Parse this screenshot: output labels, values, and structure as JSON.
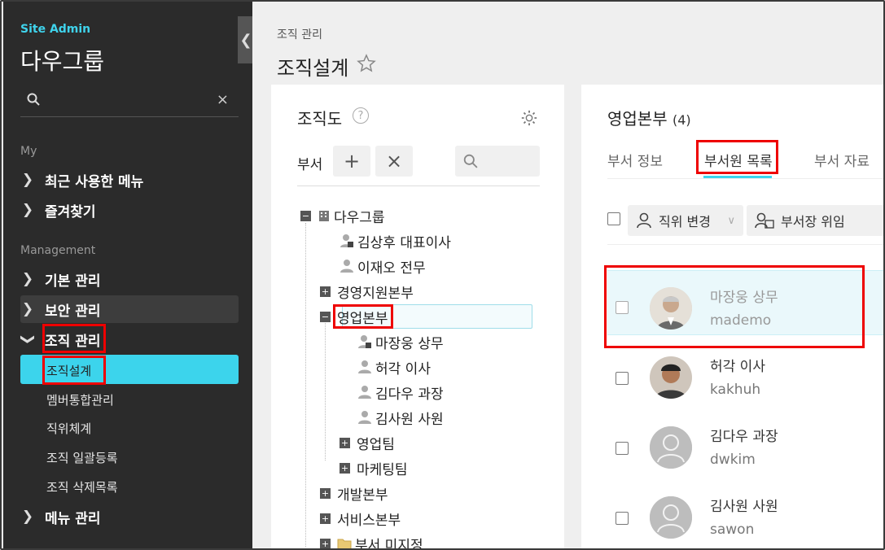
{
  "sidebar": {
    "site_admin": "Site Admin",
    "company": "다우그룹",
    "search_clear": "×",
    "sections": {
      "my": "My",
      "management": "Management"
    },
    "my_items": [
      "최근 사용한 메뉴",
      "즐겨찾기"
    ],
    "management_items": [
      "기본 관리",
      "보안 관리",
      "조직 관리"
    ],
    "org_sub_items": [
      "조직설계",
      "멤버통합관리",
      "직위체계",
      "조직 일괄등록",
      "조직 삭제목록"
    ],
    "last_item": "메뉴 관리"
  },
  "header": {
    "breadcrumb": "조직 관리",
    "title": "조직설계"
  },
  "org_panel": {
    "title": "조직도",
    "help": "?",
    "dept_label": "부서",
    "add": "+",
    "remove": "×",
    "tree": {
      "root": "다우그룹",
      "root_members": [
        "김상후 대표이사",
        "이재오 전무"
      ],
      "d1": "경영지원본부",
      "d2": "영업본부",
      "d2_members": [
        "마장웅 상무",
        "허각 이사",
        "김다우 과장",
        "김사원 사원"
      ],
      "d2_teams": [
        "영업팀",
        "마케팅팀"
      ],
      "d3": "개발본부",
      "d4": "서비스본부",
      "d5": "부서 미지정"
    }
  },
  "dept_panel": {
    "title": "영업본부",
    "count": "(4)",
    "tabs": [
      "부서 정보",
      "부서원 목록",
      "부서 자료"
    ],
    "actions": {
      "change_position": "직위 변경",
      "delegate_head": "부서장 위임"
    },
    "members": [
      {
        "name": "마장웅 상무",
        "id": "mademo"
      },
      {
        "name": "허각 이사",
        "id": "kakhuh"
      },
      {
        "name": "김다우 과장",
        "id": "dwkim"
      },
      {
        "name": "김사원 사원",
        "id": "sawon"
      }
    ]
  },
  "colors": {
    "accent": "#3cd4ec",
    "highlight_box": "#ee0000",
    "sidebar_bg": "#2b2b2b"
  }
}
